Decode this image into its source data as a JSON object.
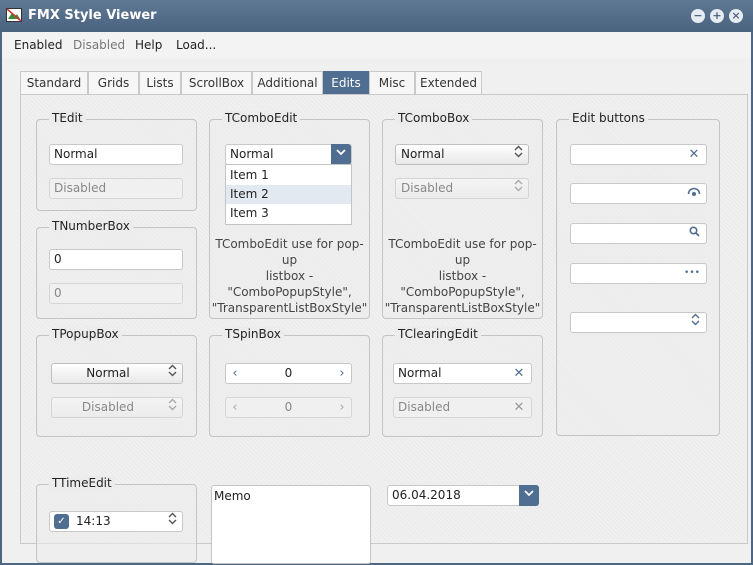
{
  "window": {
    "title": "FMX Style Viewer"
  },
  "menu": {
    "enabled": "Enabled",
    "disabled": "Disabled",
    "help": "Help",
    "load": "Load..."
  },
  "tabs": [
    "Standard",
    "Grids",
    "Lists",
    "ScrollBox",
    "Additional",
    "Edits",
    "Misc",
    "Extended"
  ],
  "active_tab": "Edits",
  "groups": {
    "tedit": {
      "label": "TEdit",
      "normal_value": "Normal",
      "disabled_value": "Disabled"
    },
    "tcomboedit": {
      "label": "TComboEdit",
      "value": "Normal",
      "items": [
        "Item 1",
        "Item 2",
        "Item 3"
      ],
      "selected_item": "Item 2",
      "note_line1": "TComboEdit use for pop-up",
      "note_line2": "listbox -",
      "note_line3": "\"ComboPopupStyle\",",
      "note_line4": "\"TransparentListBoxStyle\""
    },
    "tcombobox": {
      "label": "TComboBox",
      "normal_value": "Normal",
      "disabled_value": "Disabled",
      "note_line1": "TComboEdit use for pop-up",
      "note_line2": "listbox -",
      "note_line3": "\"ComboPopupStyle\",",
      "note_line4": "\"TransparentListBoxStyle\""
    },
    "edit_buttons": {
      "label": "Edit buttons"
    },
    "tnumberbox": {
      "label": "TNumberBox",
      "normal_value": "0",
      "disabled_value": "0"
    },
    "tpopupbox": {
      "label": "TPopupBox",
      "normal_value": "Normal",
      "disabled_value": "Disabled"
    },
    "tspinbox": {
      "label": "TSpinBox",
      "normal_value": "0",
      "disabled_value": "0"
    },
    "tclearingedit": {
      "label": "TClearingEdit",
      "normal_value": "Normal",
      "disabled_value": "Disabled"
    },
    "ttimeedit": {
      "label": "TTimeEdit",
      "value": "14:13",
      "checked": true
    }
  },
  "memo": {
    "text": "Memo"
  },
  "date_edit": {
    "value": "06.04.2018"
  },
  "icons": {
    "close": "✕",
    "chevron_down": "⌄",
    "updown": "◇",
    "ellipsis": "•••",
    "search": "search-icon",
    "password": "eye-icon"
  },
  "colors": {
    "accent": "#4f6e92",
    "titlebar": "#4d6682"
  }
}
